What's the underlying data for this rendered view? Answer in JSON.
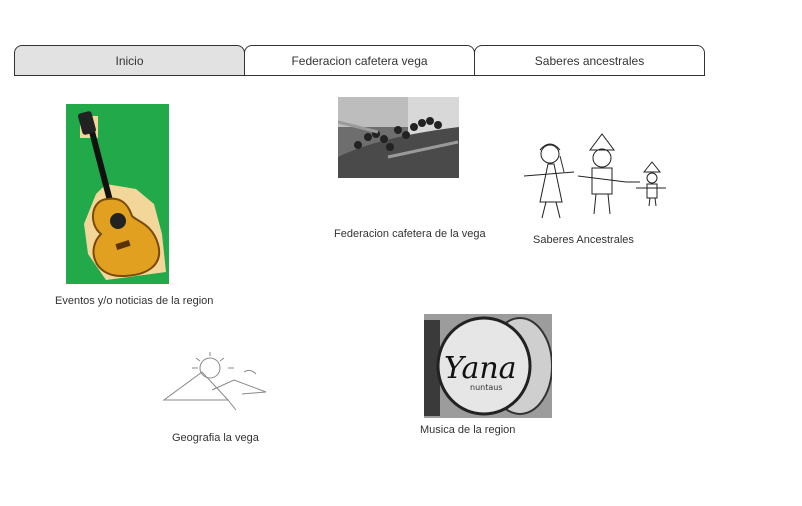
{
  "tabs": [
    {
      "label": "Inicio",
      "active": true
    },
    {
      "label": "Federacion cafetera vega",
      "active": false
    },
    {
      "label": "Saberes ancestrales",
      "active": false
    }
  ],
  "items": {
    "guitar": {
      "caption": "Eventos y/o noticias de la region"
    },
    "coffee": {
      "caption": "Federacion cafetera de la vega"
    },
    "ancestral": {
      "caption": "Saberes Ancestrales"
    },
    "geography": {
      "caption": "Geografia la vega"
    },
    "music": {
      "caption": "Musica de la region",
      "drum_text": "Yana",
      "drum_subtext": "nuntaus"
    }
  }
}
